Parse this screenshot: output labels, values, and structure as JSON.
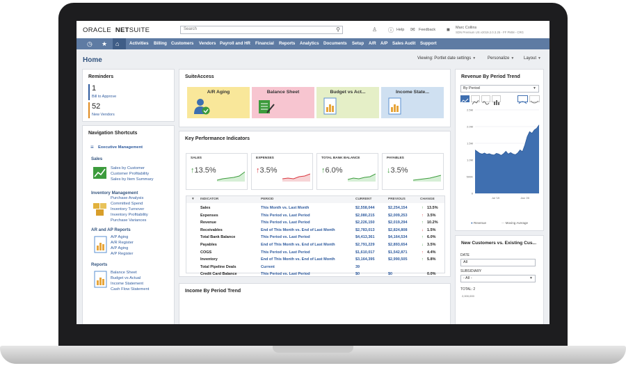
{
  "logo": {
    "oracle": "ORACLE",
    "netsuite_bold": "NET",
    "netsuite_rest": "SUITE"
  },
  "search": {
    "placeholder": "Search"
  },
  "topbar": {
    "help": "Help",
    "feedback": "Feedback",
    "user_name": "Marc Collins",
    "user_detail": "SDN Premium US v2019.2.0.3.25 - FF PMM - CRG"
  },
  "nav": {
    "items": [
      "Activities",
      "Billing",
      "Customers",
      "Vendors",
      "Payroll and HR",
      "Financial",
      "Reports",
      "Analytics",
      "Documents",
      "Setup",
      "A/R",
      "A/P",
      "Sales Audit",
      "Support"
    ]
  },
  "page": {
    "title": "Home",
    "viewing": "Viewing: Portlet date settings",
    "personalize": "Personalize",
    "layout": "Layout"
  },
  "reminders": {
    "title": "Reminders",
    "items": [
      {
        "count": "1",
        "label": "Bill to Approve",
        "color": "#2f5b9e"
      },
      {
        "count": "52",
        "label": "New Vendors",
        "color": "#e08a1e"
      }
    ]
  },
  "shortcuts": {
    "title": "Navigation Shortcuts",
    "exec": "Executive Management",
    "sales": {
      "head": "Sales",
      "links": [
        "Sales by Customer",
        "Customer Profitability",
        "Sales by Item Summary"
      ]
    },
    "inventory": {
      "head": "Inventory Management",
      "links": [
        "Purchase Analysis",
        "Committed Spend",
        "Inventory Turnover",
        "Inventory Profitability",
        "Purchase Variances"
      ]
    },
    "arap": {
      "head": "AR and AP Reports",
      "links": [
        "A/P Aging",
        "A/R Register",
        "A/P Aging",
        "A/P Register"
      ]
    },
    "reports": {
      "head": "Reports",
      "links": [
        "Balance Sheet",
        "Budget vs Actual",
        "Income Statement",
        "Cash Flow Statement"
      ]
    }
  },
  "suiteaccess": {
    "title": "SuiteAccess",
    "tiles": [
      {
        "label": "A/R Aging",
        "color": "#f9e79a"
      },
      {
        "label": "Balance Sheet",
        "color": "#f7c5d0"
      },
      {
        "label": "Budget vs Act...",
        "color": "#e5efc7"
      },
      {
        "label": "Income State...",
        "color": "#cfe0f1"
      }
    ]
  },
  "kpi": {
    "title": "Key Performance Indicators",
    "tiles": [
      {
        "label": "SALES",
        "value": "13.5%",
        "dir": "up",
        "color": "#3c9b3c"
      },
      {
        "label": "EXPENSES",
        "value": "3.5%",
        "dir": "up",
        "color": "#d9363e"
      },
      {
        "label": "TOTAL BANK BALANCE",
        "value": "6.0%",
        "dir": "up",
        "color": "#3c9b3c"
      },
      {
        "label": "PAYABLES",
        "value": "3.5%",
        "dir": "down",
        "color": "#3c9b3c"
      }
    ],
    "headers": {
      "indicator": "INDICATOR",
      "period": "PERIOD",
      "current": "CURRENT",
      "previous": "PREVIOUS",
      "change": "CHANGE"
    },
    "rows": [
      {
        "indicator": "Sales",
        "period": "This Month vs. Last Month",
        "current": "$2,558,044",
        "previous": "$2,254,154",
        "change": "13.5%",
        "dir": "up"
      },
      {
        "indicator": "Expenses",
        "period": "This Period vs. Last Period",
        "current": "$2,080,215",
        "previous": "$2,009,253",
        "change": "3.5%",
        "dir": "up-red"
      },
      {
        "indicator": "Revenue",
        "period": "This Period vs. Last Period",
        "current": "$2,226,150",
        "previous": "$2,019,294",
        "change": "10.2%",
        "dir": "up"
      },
      {
        "indicator": "Receivables",
        "period": "End of This Month vs. End of Last Month",
        "current": "$2,783,013",
        "previous": "$2,824,808",
        "change": "1.5%",
        "dir": "down-red"
      },
      {
        "indicator": "Total Bank Balance",
        "period": "This Period vs. Last Period",
        "current": "$4,413,361",
        "previous": "$4,164,534",
        "change": "6.0%",
        "dir": "up"
      },
      {
        "indicator": "Payables",
        "period": "End of This Month vs. End of Last Month",
        "current": "$2,791,229",
        "previous": "$2,893,654",
        "change": "3.5%",
        "dir": "down"
      },
      {
        "indicator": "COGS",
        "period": "This Period vs. Last Period",
        "current": "$1,610,017",
        "previous": "$1,542,871",
        "change": "4.4%",
        "dir": "up-red"
      },
      {
        "indicator": "Inventory",
        "period": "End of This Month vs. End of Last Month",
        "current": "$3,164,395",
        "previous": "$2,990,505",
        "change": "5.8%",
        "dir": "up"
      },
      {
        "indicator": "Total Pipeline Deals",
        "period": "Current",
        "current": "39",
        "previous": "",
        "change": "",
        "dir": ""
      },
      {
        "indicator": "Credit Card Balance",
        "period": "This Period vs. Last Period",
        "current": "$0",
        "previous": "$0",
        "change": "0.0%",
        "dir": ""
      }
    ]
  },
  "income": {
    "title": "Income By Period Trend"
  },
  "revenue": {
    "title": "Revenue By Period Trend",
    "select": "By Period",
    "legend": [
      "Revenue",
      "Moving Average"
    ]
  },
  "chart_data": {
    "type": "area",
    "title": "Revenue By Period Trend",
    "x_ticks": [
      "Jul '19",
      "Jan '20"
    ],
    "y_ticks": [
      "0",
      "500K",
      "1.0M",
      "1.5M",
      "2.0M",
      "2.5M"
    ],
    "ylim": [
      0,
      2500000
    ],
    "series": [
      {
        "name": "Revenue",
        "values": [
          1300000,
          1250000,
          1200000,
          1180000,
          1210000,
          1170000,
          1190000,
          1160000,
          1150000,
          1200000,
          1180000,
          1140000,
          1190000,
          1260000,
          1180000,
          1220000,
          1180000,
          1160000,
          1210000,
          1300000,
          1250000,
          1450000,
          1700000,
          1850000,
          1800000,
          1900000,
          1950000,
          2050000
        ]
      },
      {
        "name": "Moving Average",
        "values": []
      }
    ],
    "grid": true,
    "legend": "bottom"
  },
  "customers": {
    "title": "New Customers vs. Existing Cus...",
    "date_label": "DATE",
    "date_value": "All",
    "subsidiary_label": "SUBSIDIARY",
    "subsidiary_value": "- All -",
    "total_label": "TOTAL: 2",
    "axis_top": "2,000,000"
  }
}
